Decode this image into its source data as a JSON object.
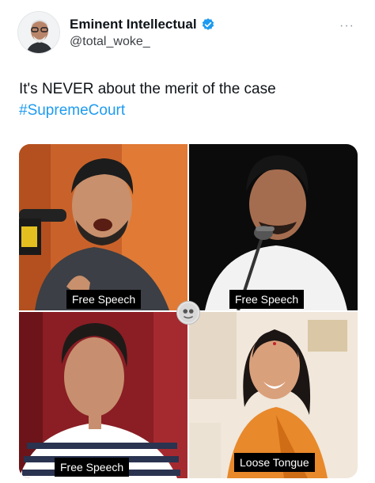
{
  "author": {
    "display_name": "Eminent Intellectual",
    "handle": "@total_woke_",
    "verified": true
  },
  "tweet": {
    "text": "It's NEVER about the merit of the case",
    "hashtag": "#SupremeCourt"
  },
  "media": {
    "tiles": [
      {
        "caption": "Free Speech"
      },
      {
        "caption": "Free Speech"
      },
      {
        "caption": "Free Speech"
      },
      {
        "caption": "Loose Tongue"
      }
    ]
  },
  "icons": {
    "verified": "verified-badge-icon",
    "more": "more-options-icon"
  },
  "colors": {
    "accent": "#1d9bf0",
    "caption_bg": "#000000"
  }
}
